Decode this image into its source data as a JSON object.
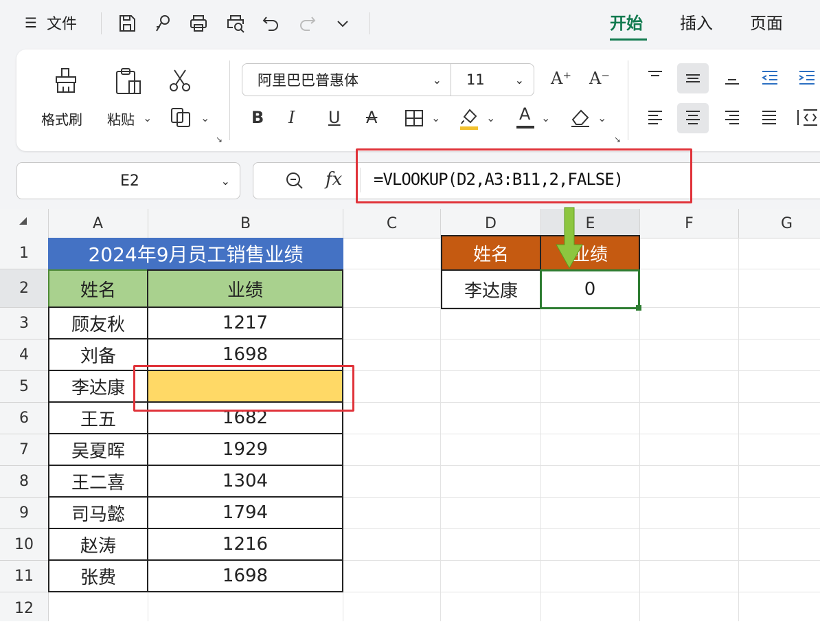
{
  "menu": {
    "menu_icon": "☰",
    "file_label": "文件"
  },
  "tabs": [
    {
      "label": "开始",
      "active": true
    },
    {
      "label": "插入"
    },
    {
      "label": "页面"
    }
  ],
  "ribbon": {
    "format_painter": "格式刷",
    "paste": "粘贴",
    "font_name": "阿里巴巴普惠体",
    "font_size": "11",
    "increase_font": "A⁺",
    "decrease_font": "A⁻",
    "bold": "B",
    "italic": "I",
    "underline": "U",
    "strike": "A",
    "font_color_letter": "A"
  },
  "formula_bar": {
    "name_box": "E2",
    "fx": "fx",
    "formula": "=VLOOKUP(D2,A3:B11,2,FALSE)"
  },
  "columns": [
    "A",
    "B",
    "C",
    "D",
    "E",
    "F",
    "G"
  ],
  "rows": [
    "1",
    "2",
    "3",
    "4",
    "5",
    "6",
    "7",
    "8",
    "9",
    "10",
    "11",
    "12"
  ],
  "table": {
    "title": "2024年9月员工销售业绩",
    "header_name": "姓名",
    "header_score": "业绩",
    "rows": [
      {
        "name": "顾友秋",
        "score": "1217"
      },
      {
        "name": "刘备",
        "score": "1698"
      },
      {
        "name": "李达康",
        "score": ""
      },
      {
        "name": "王五",
        "score": "1682"
      },
      {
        "name": "吴夏晖",
        "score": "1929"
      },
      {
        "name": "王二喜",
        "score": "1304"
      },
      {
        "name": "司马懿",
        "score": "1794"
      },
      {
        "name": "赵涛",
        "score": "1216"
      },
      {
        "name": "张费",
        "score": "1698"
      }
    ]
  },
  "lookup": {
    "header_name": "姓名",
    "header_score": "业绩",
    "name": "李达康",
    "result": "0"
  },
  "colors": {
    "title_bg": "#4472c4",
    "header_bg": "#a9d18e",
    "lookup_header_bg": "#c55a11",
    "highlight": "#ffd966",
    "accent_green": "#127a4f",
    "red_outline": "#e0333a",
    "arrow": "#8dc63f"
  }
}
